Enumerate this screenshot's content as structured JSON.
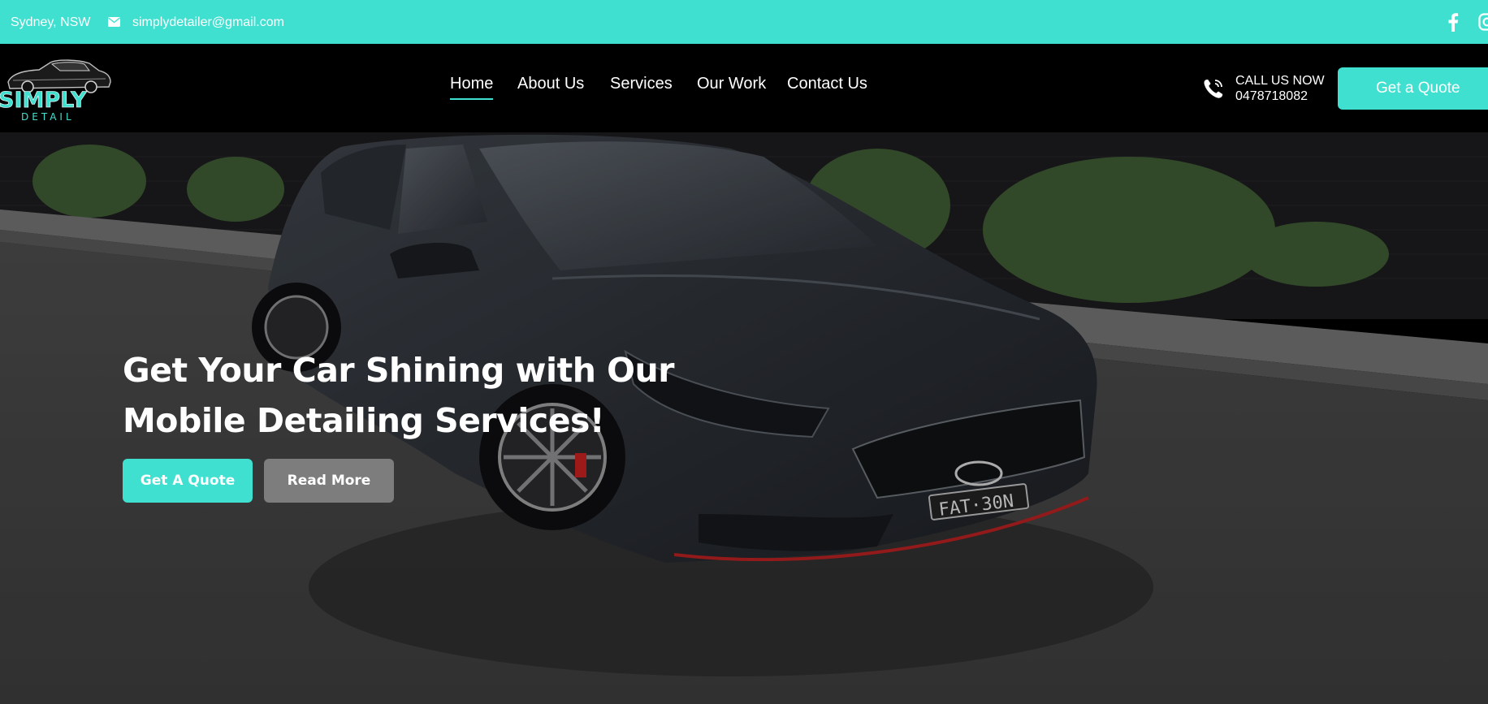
{
  "topbar": {
    "location": "Sydney, NSW",
    "email": "simplydetailer@gmail.com",
    "icons": [
      "mail-icon",
      "facebook-icon",
      "instagram-icon"
    ]
  },
  "header": {
    "logo": {
      "top": "SIMPLY",
      "bottom": "DETAIL"
    },
    "nav": [
      {
        "label": "Home",
        "active": true
      },
      {
        "label": "About Us"
      },
      {
        "label": "Services"
      },
      {
        "label": "Our Work"
      },
      {
        "label": "Contact Us"
      }
    ],
    "call": {
      "label": "CALL US NOW",
      "number": "0478718082"
    },
    "quote_button": "Get a Quote"
  },
  "hero": {
    "title_line1": "Get Your Car Shining with Our",
    "title_line2": "Mobile Detailing Services!",
    "primary_button": "Get A Quote",
    "secondary_button": "Read More",
    "plate": "FAT·30N"
  },
  "colors": {
    "accent": "#40e0d0",
    "header_bg": "#000000",
    "secondary_button": "#7d7d7d"
  }
}
